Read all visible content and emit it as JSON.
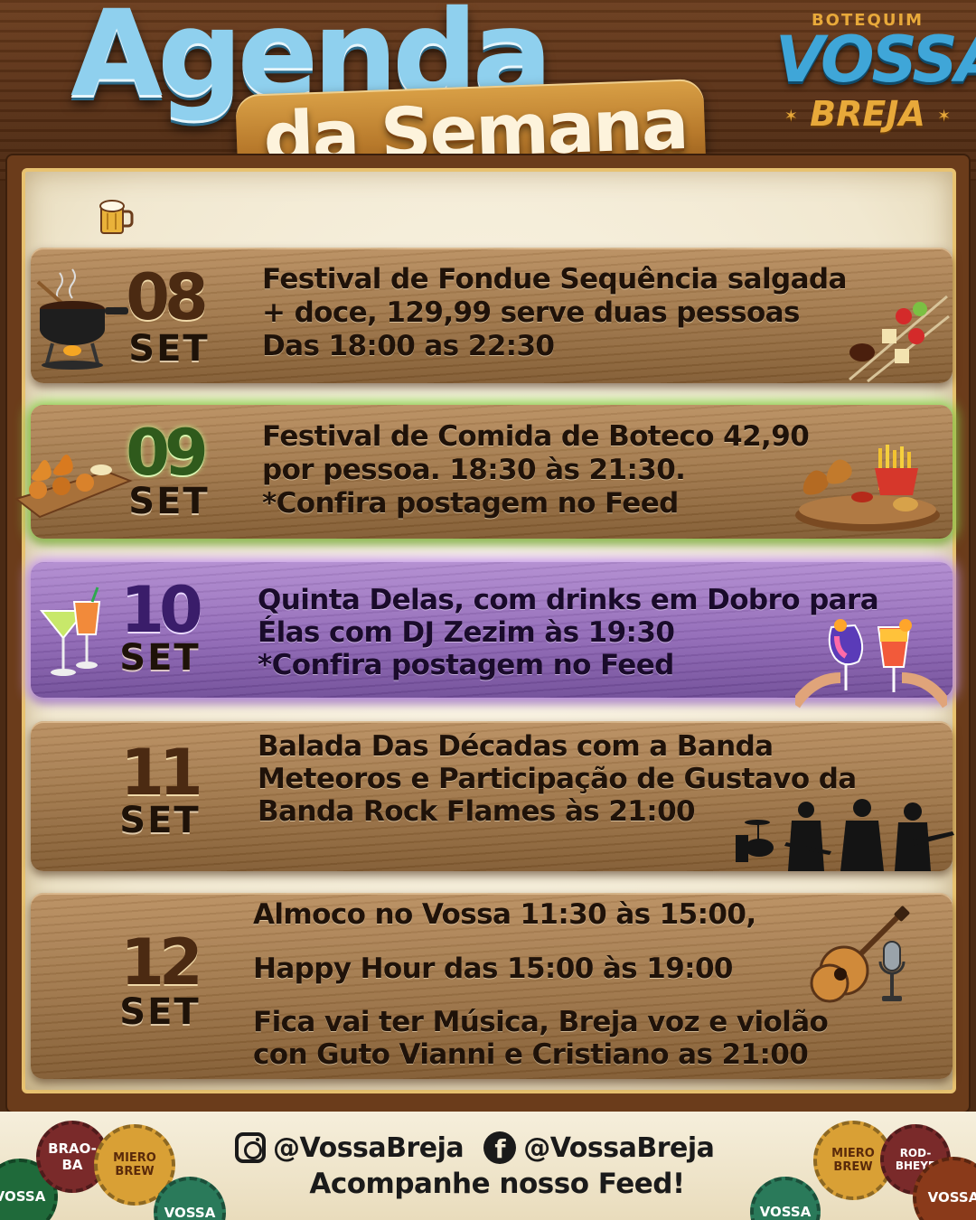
{
  "header": {
    "title_line1": "Agenda",
    "title_line2": "da Semana",
    "logo": {
      "top": "BOTEQUIM",
      "main": "VOSSA",
      "sub": "BREJA"
    }
  },
  "events": [
    {
      "day": "08",
      "month": "SET",
      "lines": [
        "Festival de Fondue Sequência salgada",
        "+ doce, 129,99 serve duas pessoas",
        "Das 18:00 as 22:30"
      ],
      "art_left": "fondue-pot-icon",
      "art_right": "fondue-skewers-icon"
    },
    {
      "day": "09",
      "month": "SET",
      "lines": [
        "Festival de Comida de Boteco 42,90",
        "por pessoa. 18:30 às 21:30.",
        "*Confira postagem no Feed"
      ],
      "art_left": "coxinha-board-icon",
      "art_right": "snack-platter-icon"
    },
    {
      "day": "10",
      "month": "SET",
      "lines": [
        "Quinta Delas, com drinks em Dobro para",
        "Élas com DJ Zezim às 19:30",
        "*Confira postagem no Feed"
      ],
      "art_left": "cocktail-glasses-icon",
      "art_right": "drinks-toast-icon"
    },
    {
      "day": "11",
      "month": "SET",
      "lines": [
        "Balada Das Décadas com a Banda",
        "Meteoros e Participação de Gustavo da",
        "Banda Rock Flames às 21:00"
      ],
      "art_right": "band-silhouette-icon"
    },
    {
      "day": "12",
      "month": "SET",
      "lines": [
        "Almoco no Vossa 11:30 às 15:00,",
        "Happy Hour das 15:00 às 19:00",
        "Fica vai ter Música, Breja voz e violão",
        "con Guto Vianni e Cristiano as 21:00"
      ],
      "art_right": "guitar-microphone-icon"
    }
  ],
  "footer": {
    "instagram": "@VossaBreja",
    "facebook": "@VossaBreja",
    "tagline": "Acompanhe nosso Feed!",
    "caps": [
      "VOSSA",
      "MIERO BREW",
      "BRAO-BA",
      "VOSSA",
      "VOSSA",
      "MIERO BREW",
      "ROD-BHEYE",
      "VOSSA"
    ]
  },
  "colors": {
    "wood": "#9c7346",
    "green_glow": "#8fd34f",
    "purple": "#9068b6",
    "title_blue": "#8fd0ee",
    "gold": "#d9a046"
  }
}
